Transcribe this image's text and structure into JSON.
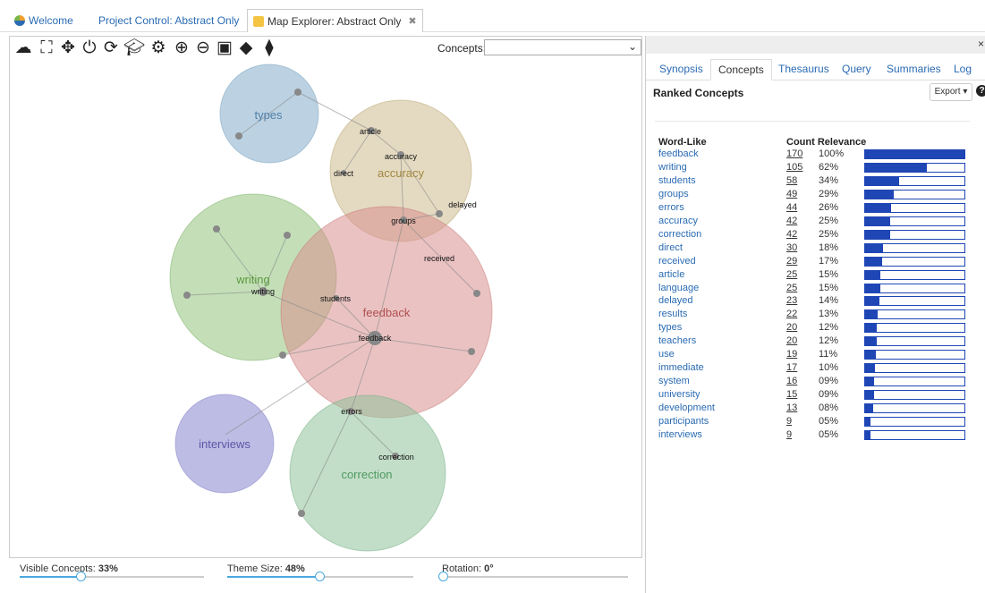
{
  "tabs": [
    {
      "label": "Welcome",
      "icon": "globe-icon"
    },
    {
      "label": "Project Control: Abstract Only",
      "close": "✖"
    },
    {
      "label": "Map Explorer: Abstract Only",
      "close": "✖",
      "icon": "map-icon"
    }
  ],
  "toolbar": {
    "icons": [
      "cloud-icon",
      "fit-icon",
      "move-icon",
      "power-icon",
      "refresh-icon",
      "graduation-cap-icon",
      "settings-icon",
      "zoom-in-icon",
      "zoom-out-icon",
      "image-icon",
      "tag-icon",
      "tags-icon"
    ],
    "concepts_label": "Concepts:",
    "concepts_value": ""
  },
  "map": {
    "themes": [
      {
        "name": "types",
        "color": "#8fb4cf"
      },
      {
        "name": "accuracy",
        "color": "#c9b684"
      },
      {
        "name": "writing",
        "color": "#93c47d"
      },
      {
        "name": "feedback",
        "color": "#d88f8f"
      },
      {
        "name": "interviews",
        "color": "#9a98d6"
      },
      {
        "name": "correction",
        "color": "#8fc39a"
      }
    ],
    "concepts": [
      "article",
      "accuracy",
      "direct",
      "delayed",
      "groups",
      "received",
      "writing",
      "students",
      "feedback",
      "errors",
      "correction"
    ]
  },
  "sliders": {
    "visible_concepts": {
      "label": "Visible Concepts:",
      "value": "33%",
      "level": 0.33
    },
    "theme_size": {
      "label": "Theme Size:",
      "value": "48%",
      "level": 0.48
    },
    "rotation": {
      "label": "Rotation:",
      "value": "0°",
      "level": 0
    }
  },
  "right": {
    "close": "×",
    "tabs": [
      "Synopsis",
      "Concepts",
      "Thesaurus",
      "Query",
      "Summaries",
      "Log"
    ],
    "active_tab": "Concepts",
    "title": "Ranked Concepts",
    "export_label": "Export ▾",
    "help": "?",
    "columns": {
      "word": "Word-Like",
      "count_relevance": "Count Relevance"
    },
    "rows": [
      {
        "word": "feedback",
        "count": "170",
        "relevance": "100%",
        "pct": 100
      },
      {
        "word": "writing",
        "count": "105",
        "relevance": "62%",
        "pct": 62
      },
      {
        "word": "students",
        "count": "58",
        "relevance": "34%",
        "pct": 34
      },
      {
        "word": "groups",
        "count": "49",
        "relevance": "29%",
        "pct": 29
      },
      {
        "word": "errors",
        "count": "44",
        "relevance": "26%",
        "pct": 26
      },
      {
        "word": "accuracy",
        "count": "42",
        "relevance": "25%",
        "pct": 25
      },
      {
        "word": "correction",
        "count": "42",
        "relevance": "25%",
        "pct": 25
      },
      {
        "word": "direct",
        "count": "30",
        "relevance": "18%",
        "pct": 18
      },
      {
        "word": "received",
        "count": "29",
        "relevance": "17%",
        "pct": 17
      },
      {
        "word": "article",
        "count": "25",
        "relevance": "15%",
        "pct": 15
      },
      {
        "word": "language",
        "count": "25",
        "relevance": "15%",
        "pct": 15
      },
      {
        "word": "delayed",
        "count": "23",
        "relevance": "14%",
        "pct": 14
      },
      {
        "word": "results",
        "count": "22",
        "relevance": "13%",
        "pct": 13
      },
      {
        "word": "types",
        "count": "20",
        "relevance": "12%",
        "pct": 12
      },
      {
        "word": "teachers",
        "count": "20",
        "relevance": "12%",
        "pct": 12
      },
      {
        "word": "use",
        "count": "19",
        "relevance": "11%",
        "pct": 11
      },
      {
        "word": "immediate",
        "count": "17",
        "relevance": "10%",
        "pct": 10
      },
      {
        "word": "system",
        "count": "16",
        "relevance": "09%",
        "pct": 9
      },
      {
        "word": "university",
        "count": "15",
        "relevance": "09%",
        "pct": 9
      },
      {
        "word": "development",
        "count": "13",
        "relevance": "08%",
        "pct": 8
      },
      {
        "word": "participants",
        "count": "9",
        "relevance": "05%",
        "pct": 5
      },
      {
        "word": "interviews",
        "count": "9",
        "relevance": "05%",
        "pct": 5
      }
    ]
  }
}
